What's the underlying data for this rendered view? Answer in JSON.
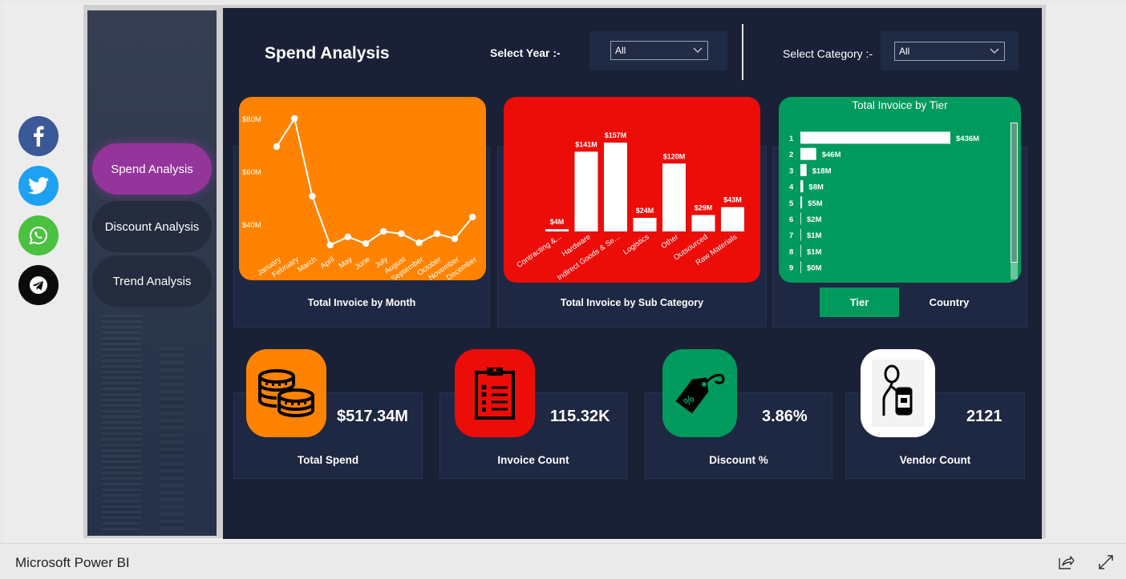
{
  "app": {
    "brand": "Microsoft Power BI"
  },
  "social": [
    {
      "name": "facebook",
      "icon": "facebook-icon",
      "color": "#3b5998"
    },
    {
      "name": "twitter",
      "icon": "twitter-icon",
      "color": "#1da1f2"
    },
    {
      "name": "whatsapp",
      "icon": "whatsapp-icon",
      "color": "#4ac13f"
    },
    {
      "name": "telegram",
      "icon": "telegram-icon",
      "color": "#0b0b0b"
    }
  ],
  "nav": {
    "items": [
      {
        "label": "Spend Analysis",
        "active": true
      },
      {
        "label": "Discount Analysis",
        "active": false
      },
      {
        "label": "Trend Analysis",
        "active": false
      }
    ]
  },
  "header": {
    "title": "Spend Analysis",
    "year_filter": {
      "label": "Select Year :-",
      "value": "All"
    },
    "category_filter": {
      "label": "Select Category :-",
      "value": "All"
    }
  },
  "colors": {
    "orange": "#ff8300",
    "red": "#ec0c08",
    "green": "#009a5e",
    "purple": "#93359a",
    "canvas": "#1a2137"
  },
  "chart_data": [
    {
      "type": "line",
      "title": "Total Invoice by Month",
      "xlabel": "",
      "ylabel": "",
      "categories": [
        "January",
        "February",
        "March",
        "April",
        "May",
        "June",
        "July",
        "August",
        "September",
        "October",
        "November",
        "December"
      ],
      "values": [
        69.4,
        80.0,
        50.6,
        32.1,
        35.2,
        32.7,
        37.3,
        36.4,
        33.0,
        36.4,
        34.5,
        42.7
      ],
      "unit": "$M",
      "yticks": [
        "$40M",
        "$60M",
        "$80M"
      ],
      "ytick_values": [
        40,
        60,
        80
      ],
      "ylim": [
        28,
        82
      ],
      "grid": false
    },
    {
      "type": "bar",
      "title": "Total Invoice by Sub Category",
      "categories": [
        "Contracting &...",
        "Hardware",
        "Indirect Goods & Se...",
        "Logistics",
        "Other",
        "Outsourced",
        "Raw Materials"
      ],
      "values": [
        4,
        141,
        157,
        24,
        120,
        29,
        43
      ],
      "data_labels": [
        "$4M",
        "$141M",
        "$157M",
        "$24M",
        "$120M",
        "$29M",
        "$43M"
      ],
      "unit": "$M",
      "ylim": [
        0,
        160
      ]
    },
    {
      "type": "bar",
      "orientation": "horizontal",
      "title": "Total Invoice by Tier",
      "categories": [
        "1",
        "2",
        "3",
        "4",
        "5",
        "6",
        "7",
        "8",
        "9"
      ],
      "values": [
        436,
        46,
        18,
        8,
        5,
        2,
        1,
        1,
        0
      ],
      "data_labels": [
        "$436M",
        "$46M",
        "$18M",
        "$8M",
        "$5M",
        "$2M",
        "$1M",
        "$1M",
        "$0M"
      ],
      "unit": "$M",
      "xlim": [
        0,
        436
      ]
    }
  ],
  "tier_toggle": {
    "options": [
      "Tier",
      "Country"
    ],
    "selected": "Tier"
  },
  "kpis": [
    {
      "label": "Total Spend",
      "value": "$517.34M",
      "icon": "coins-icon",
      "color": "#ff8300"
    },
    {
      "label": "Invoice Count",
      "value": "115.32K",
      "icon": "clipboard-checklist-icon",
      "color": "#ec0c08"
    },
    {
      "label": "Discount %",
      "value": "3.86%",
      "icon": "discount-tag-icon",
      "color": "#009a5e"
    },
    {
      "label": "Vendor Count",
      "value": "2121",
      "icon": "vendor-person-icon",
      "color": "#ffffff"
    }
  ],
  "footer": {
    "share_icon": "share-icon",
    "expand_icon": "fullscreen-icon"
  }
}
